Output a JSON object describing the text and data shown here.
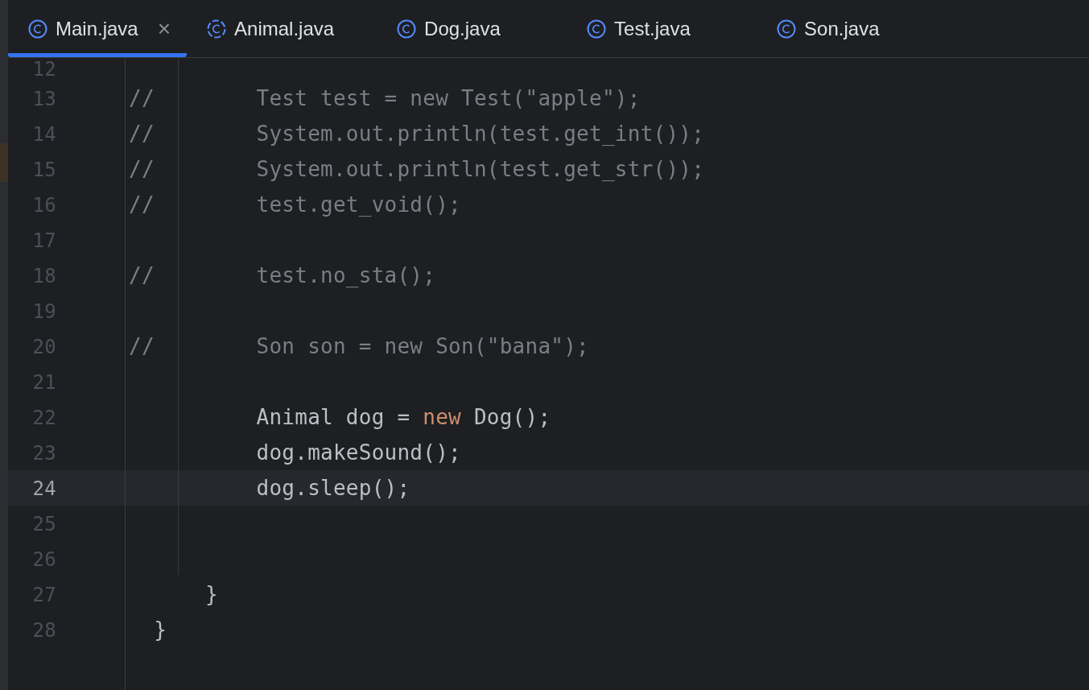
{
  "tabs": [
    {
      "label": "Main.java",
      "kind": "class",
      "selected": true,
      "close": "×"
    },
    {
      "label": "Animal.java",
      "kind": "abstract",
      "selected": false
    },
    {
      "label": "Dog.java",
      "kind": "class",
      "selected": false
    },
    {
      "label": "Test.java",
      "kind": "class",
      "selected": false
    },
    {
      "label": "Son.java",
      "kind": "class",
      "selected": false
    }
  ],
  "lines": [
    {
      "number": "12",
      "current": false
    },
    {
      "number": "13",
      "current": false,
      "comment_mark": "//",
      "tokens": [
        {
          "text": "        Test test = new Test(\"apple\");",
          "kind": "commented"
        }
      ]
    },
    {
      "number": "14",
      "current": false,
      "comment_mark": "//",
      "tokens": [
        {
          "text": "        System.out.println(test.get_int());",
          "kind": "commented"
        }
      ]
    },
    {
      "number": "15",
      "current": false,
      "comment_mark": "//",
      "tokens": [
        {
          "text": "        System.out.println(test.get_str());",
          "kind": "commented"
        }
      ]
    },
    {
      "number": "16",
      "current": false,
      "comment_mark": "//",
      "tokens": [
        {
          "text": "        test.get_void();",
          "kind": "commented"
        }
      ]
    },
    {
      "number": "17",
      "current": false
    },
    {
      "number": "18",
      "current": false,
      "comment_mark": "//",
      "tokens": [
        {
          "text": "        test.no_sta();",
          "kind": "commented"
        }
      ]
    },
    {
      "number": "19",
      "current": false
    },
    {
      "number": "20",
      "current": false,
      "comment_mark": "//",
      "tokens": [
        {
          "text": "        Son son = new Son(\"bana\");",
          "kind": "commented"
        }
      ]
    },
    {
      "number": "21",
      "current": false
    },
    {
      "number": "22",
      "current": false,
      "tokens": [
        {
          "text": "        Animal dog = ",
          "kind": "plain"
        },
        {
          "text": "new",
          "kind": "keyword"
        },
        {
          "text": " Dog();",
          "kind": "plain"
        }
      ]
    },
    {
      "number": "23",
      "current": false,
      "tokens": [
        {
          "text": "        dog.makeSound();",
          "kind": "plain"
        }
      ]
    },
    {
      "number": "24",
      "current": true,
      "tokens": [
        {
          "text": "        dog.sleep();",
          "kind": "plain"
        }
      ]
    },
    {
      "number": "25",
      "current": false
    },
    {
      "number": "26",
      "current": false
    },
    {
      "number": "27",
      "current": false,
      "tokens": [
        {
          "text": "    }",
          "kind": "plain"
        }
      ]
    },
    {
      "number": "28",
      "current": false,
      "tokens": [
        {
          "text": "}",
          "kind": "plain"
        }
      ]
    }
  ]
}
